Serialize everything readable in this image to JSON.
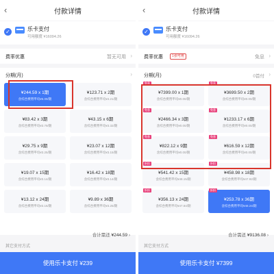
{
  "left": {
    "header_title": "付款详情",
    "back_icon": "back-arrow-icon",
    "pay_method": {
      "name": "乐卡支付",
      "sub": "可用额度 ¥16094.26"
    },
    "rate": {
      "label": "费率优惠",
      "value": "暂无可用"
    },
    "installment": {
      "label": "分期(月)",
      "value": ""
    },
    "options": [
      {
        "main": "¥244.59 x 1期",
        "fee": "含综合费用平均¥5.09/期",
        "selected": true
      },
      {
        "main": "¥123.71 x 2期",
        "fee": "含综合费用平均¥4.21/期"
      },
      {
        "main": "¥83.42 x 3期",
        "fee": "含综合费用平均¥3.79/期"
      },
      {
        "main": "¥43.15 x 6期",
        "fee": "含综合费用平均¥3.32/期"
      },
      {
        "main": "¥29.75 x 9期",
        "fee": "含综合费用平均¥3.25/期"
      },
      {
        "main": "¥23.07 x 12期",
        "fee": "含综合费用平均¥3.15/期"
      },
      {
        "main": "¥19.07 x 15期",
        "fee": "含综合费用平均¥3.14/期"
      },
      {
        "main": "¥16.42 x 18期",
        "fee": "含综合费用平均¥3.14/期"
      },
      {
        "main": "¥13.12 x 24期",
        "fee": "含综合费用平均¥3.16/期"
      },
      {
        "main": "¥9.89 x 36期",
        "fee": "含综合费用平均¥3.25/期"
      }
    ],
    "total_label": "合计需还",
    "total_value": "¥244.59",
    "other_pay": "其它支付方式",
    "pay_button": "使用乐卡支付 ¥239"
  },
  "right": {
    "header_title": "付款详情",
    "back_icon": "back-arrow-icon",
    "pay_method": {
      "name": "乐卡支付",
      "sub": "可用额度 ¥16094.26"
    },
    "rate": {
      "label": "费率优惠",
      "tag": "1张可用",
      "value": "免息"
    },
    "installment": {
      "label": "分期(月)",
      "value": "0首付"
    },
    "options": [
      {
        "main": "¥7399.00 x 1期",
        "fee": "含综合费用平均¥0.00/期",
        "badge": "免息"
      },
      {
        "main": "¥3699.50 x 2期",
        "fee": "含综合费用平均¥0.00/期",
        "badge": "免息"
      },
      {
        "main": "¥2466.34 x 3期",
        "fee": "含综合费用平均¥0.00/期",
        "badge": "免息"
      },
      {
        "main": "¥1233.17 x 6期",
        "fee": "含综合费用平均¥0.00/期",
        "badge": "免息"
      },
      {
        "main": "¥822.12 x 9期",
        "fee": "含综合费用平均¥0.00/期",
        "badge": "免息"
      },
      {
        "main": "¥616.59 x 12期",
        "fee": "含综合费用平均¥0.00/期",
        "badge": "免息"
      },
      {
        "main": "¥541.42 x 15期",
        "fee": "含综合费用平均¥48.15/期",
        "badge": "折扣"
      },
      {
        "main": "¥458.98 x 18期",
        "fee": "含综合费用平均¥47.92/期",
        "badge": "折扣"
      },
      {
        "main": "¥356.13 x 24期",
        "fee": "含综合费用平均¥47.84/期",
        "badge": "折扣"
      },
      {
        "main": "¥253.78 x 36期",
        "fee": "含综合费用平均¥48.24/期",
        "badge": "折扣",
        "selected": true
      }
    ],
    "total_label": "合计需还",
    "total_value": "¥9136.08",
    "other_pay": "其它支付方式",
    "pay_button": "使用乐卡支付 ¥7399"
  },
  "colors": {
    "accent": "#3f78f6",
    "highlight": "#d9342b",
    "badge": "#e8417b"
  },
  "icons": {
    "check": "check-circle-icon",
    "card": "card-icon",
    "chevron": "chevron-right-icon"
  }
}
